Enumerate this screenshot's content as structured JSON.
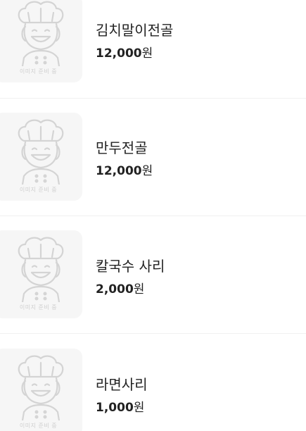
{
  "menu": {
    "placeholder_caption": "이미지 준비 중",
    "placeholder_icon": "chef-placeholder-icon",
    "items": [
      {
        "name": "김치말이전골",
        "price": "12,000",
        "currency": "원"
      },
      {
        "name": "만두전골",
        "price": "12,000",
        "currency": "원"
      },
      {
        "name": "칼국수 사리",
        "price": "2,000",
        "currency": "원"
      },
      {
        "name": "라면사리",
        "price": "1,000",
        "currency": "원"
      }
    ]
  }
}
